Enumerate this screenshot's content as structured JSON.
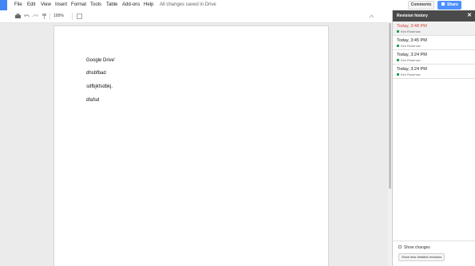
{
  "menubar": {
    "items": [
      "File",
      "Edit",
      "View",
      "Insert",
      "Format",
      "Tools",
      "Table",
      "Add-ons",
      "Help"
    ],
    "save_status": "All changes saved in Drive",
    "comments_label": "Comments",
    "share_label": "Share"
  },
  "toolbar": {
    "zoom": "100%"
  },
  "document": {
    "lines": [
      "Google Drive'",
      "dhsbfbad",
      "sdfbjkfsdbkj.",
      "dfafsd"
    ]
  },
  "revisions": {
    "title": "Revision history",
    "items": [
      {
        "time": "Today, 3:48 PM",
        "author": "Kim Rosenow",
        "active": true
      },
      {
        "time": "Today, 3:45 PM",
        "author": "Kim Rosenow",
        "active": false
      },
      {
        "time": "Today, 3:24 PM",
        "author": "Kim Rosenow",
        "active": false
      },
      {
        "time": "Today, 3:24 PM",
        "author": "Kim Rosenow",
        "active": false
      }
    ],
    "show_changes_label": "Show changes",
    "less_detailed_label": "Show less detailed revisions"
  },
  "colors": {
    "brand_blue": "#4285f4",
    "share_blue": "#4d90fe",
    "active_revision_red": "#d14836",
    "author_green": "#1e9f5a"
  }
}
